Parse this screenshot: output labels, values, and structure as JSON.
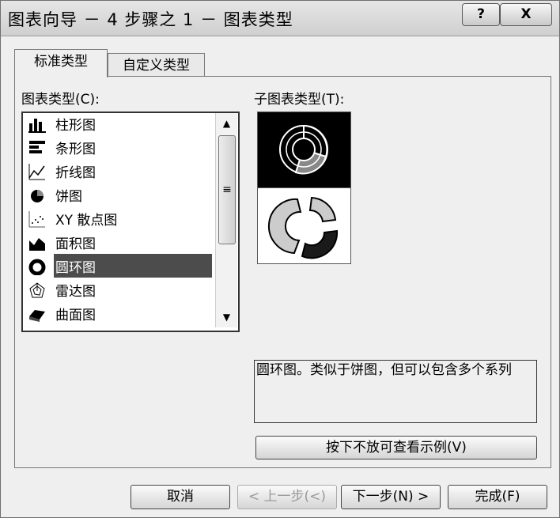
{
  "window": {
    "title": "图表向导 － 4 步骤之 1 － 图表类型",
    "help_label": "?",
    "close_label": "X"
  },
  "tabs": [
    {
      "label": "标准类型",
      "active": true
    },
    {
      "label": "自定义类型",
      "active": false
    }
  ],
  "chart_types": {
    "label": "图表类型(C):",
    "items": [
      {
        "label": "柱形图",
        "icon": "column-chart-icon"
      },
      {
        "label": "条形图",
        "icon": "bar-chart-icon"
      },
      {
        "label": "折线图",
        "icon": "line-chart-icon"
      },
      {
        "label": "饼图",
        "icon": "pie-chart-icon"
      },
      {
        "label": "XY 散点图",
        "icon": "scatter-chart-icon"
      },
      {
        "label": "面积图",
        "icon": "area-chart-icon"
      },
      {
        "label": "圆环图",
        "icon": "doughnut-chart-icon",
        "selected": true
      },
      {
        "label": "雷达图",
        "icon": "radar-chart-icon"
      },
      {
        "label": "曲面图",
        "icon": "surface-chart-icon"
      }
    ]
  },
  "sub_types": {
    "label": "子图表类型(T):"
  },
  "description": "圆环图。类似于饼图，但可以包含多个系列",
  "preview_button": "按下不放可查看示例(V)",
  "footer": {
    "cancel": "取消",
    "back": "< 上一步(<)",
    "next": "下一步(N) >",
    "finish": "完成(F)"
  },
  "colors": {
    "selection": "#4c4c4c",
    "thumb_selected_bg": "#000000"
  }
}
